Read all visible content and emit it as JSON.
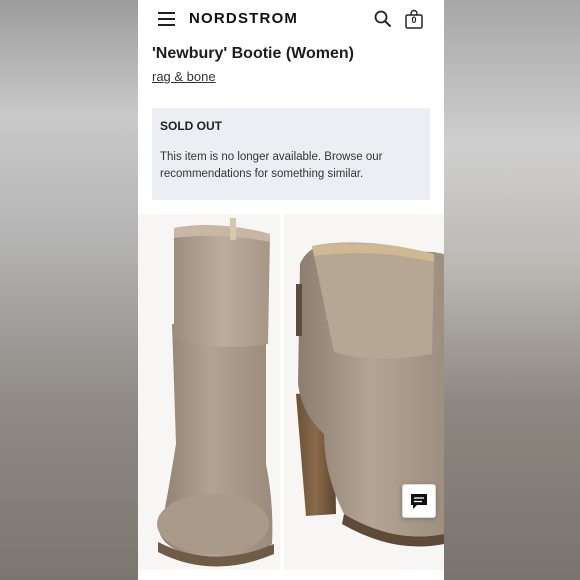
{
  "header": {
    "brand": "NORDSTROM",
    "bag_count": "0"
  },
  "product": {
    "title": "'Newbury' Bootie (Women)",
    "brand_link": "rag & bone"
  },
  "notice": {
    "heading": "SOLD OUT",
    "message": "This item is no longer available. Browse our recommendations for something similar."
  },
  "icons": {
    "menu": "hamburger-menu-icon",
    "search": "search-icon",
    "bag": "shopping-bag-icon",
    "chat": "chat-icon"
  },
  "colors": {
    "notice_bg": "#ebeff3",
    "suede": "#a8998a"
  }
}
